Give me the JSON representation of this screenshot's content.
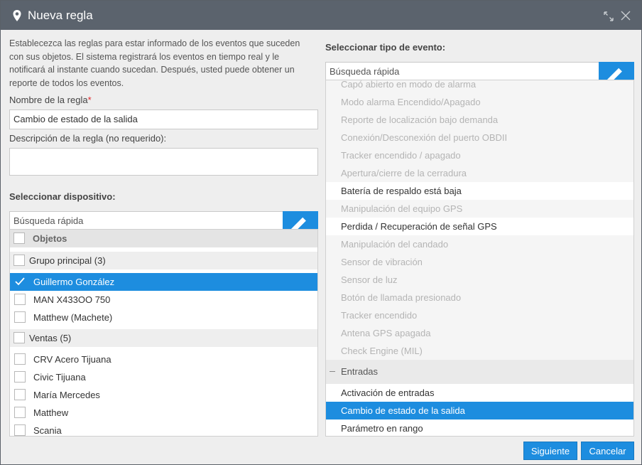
{
  "dialog": {
    "title": "Nueva regla",
    "intro": "Establecezca las reglas para estar informado de los eventos que suceden con sus objetos. El sistema registrará los eventos en tiempo real y le notificará al instante cuando sucedan. Después, usted puede obtener un reporte de todos los eventos."
  },
  "form": {
    "name_label": "Nombre de la regla",
    "required_mark": "*",
    "name_value": "Cambio de estado de la salida",
    "desc_label": "Descripción de la regla (no requerido):",
    "desc_value": ""
  },
  "devices": {
    "heading": "Seleccionar dispositivo:",
    "search_placeholder": "Búsqueda rápida",
    "header_label": "Objetos",
    "groups": [
      {
        "label": "Grupo principal (3)",
        "items": [
          "Guillermo González",
          "MAN X433OO 750",
          "Matthew (Machete)"
        ]
      },
      {
        "label": "Ventas (5)",
        "items": [
          "CRV Acero Tijuana",
          "Civic Tijuana",
          "María Mercedes",
          "Matthew",
          "Scania"
        ]
      }
    ],
    "selected": "Guillermo González"
  },
  "events": {
    "heading": "Seleccionar tipo de evento:",
    "search_placeholder": "Búsqueda rápida",
    "items": [
      {
        "label": "Capó abierto en modo de alarma",
        "state": "disabled"
      },
      {
        "label": "Modo alarma Encendido/Apagado",
        "state": "disabled"
      },
      {
        "label": "Reporte de localización bajo demanda",
        "state": "disabled"
      },
      {
        "label": "Conexión/Desconexión del puerto OBDII",
        "state": "disabled"
      },
      {
        "label": "Tracker encendido / apagado",
        "state": "disabled"
      },
      {
        "label": "Apertura/cierre de la cerradura",
        "state": "disabled"
      },
      {
        "label": "Batería de respaldo está baja",
        "state": "enabled"
      },
      {
        "label": "Manipulación del equipo GPS",
        "state": "disabled"
      },
      {
        "label": "Perdida / Recuperación de señal GPS",
        "state": "enabled"
      },
      {
        "label": "Manipulación del candado",
        "state": "disabled"
      },
      {
        "label": "Sensor de vibración",
        "state": "disabled"
      },
      {
        "label": "Sensor de luz",
        "state": "disabled"
      },
      {
        "label": "Botón de llamada presionado",
        "state": "disabled"
      },
      {
        "label": "Tracker encendido",
        "state": "disabled"
      },
      {
        "label": "Antena GPS apagada",
        "state": "disabled"
      },
      {
        "label": "Check Engine (MIL)",
        "state": "disabled"
      }
    ],
    "group_label": "Entradas",
    "group_items": [
      {
        "label": "Activación de entradas",
        "state": "enabled"
      },
      {
        "label": "Cambio de estado de la salida",
        "state": "selected"
      },
      {
        "label": "Parámetro en rango",
        "state": "enabled"
      }
    ]
  },
  "buttons": {
    "next": "Siguiente",
    "cancel": "Cancelar"
  },
  "icons": {
    "title": "map-pin-icon",
    "expand": "expand-icon",
    "close": "close-icon",
    "prev": "chevron-left-icon",
    "next": "chevron-right-icon",
    "check": "checkmark-icon",
    "collapse": "minus-icon"
  },
  "colors": {
    "titlebar": "#5b636d",
    "accent": "#1d8ddf",
    "required": "#e0262a",
    "disabled_text": "#b4b4b4"
  }
}
